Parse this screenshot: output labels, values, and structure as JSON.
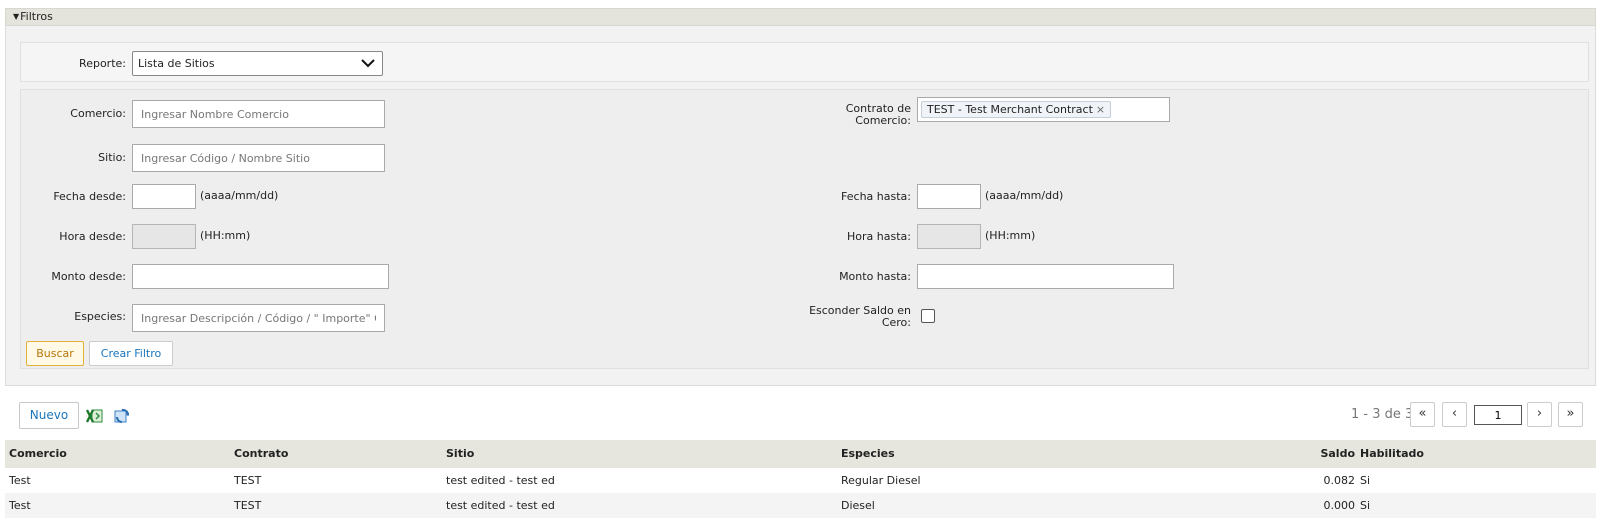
{
  "filters": {
    "header": "Filtros",
    "report": {
      "label": "Reporte:",
      "selected": "Lista de Sitios"
    },
    "comercio": {
      "label": "Comercio:",
      "placeholder": "Ingresar Nombre Comercio"
    },
    "contrato": {
      "label_line1": "Contrato de",
      "label_line2": "Comercio:",
      "tag": "TEST - Test Merchant Contract"
    },
    "sitio": {
      "label": "Sitio:",
      "placeholder": "Ingresar Código / Nombre Sitio"
    },
    "fecha_desde": {
      "label": "Fecha desde:",
      "hint": "(aaaa/mm/dd)"
    },
    "fecha_hasta": {
      "label": "Fecha hasta:",
      "hint": "(aaaa/mm/dd)"
    },
    "hora_desde": {
      "label": "Hora desde:",
      "hint": "(HH:mm)"
    },
    "hora_hasta": {
      "label": "Hora hasta:",
      "hint": "(HH:mm)"
    },
    "monto_desde": {
      "label": "Monto desde:"
    },
    "monto_hasta": {
      "label": "Monto hasta:"
    },
    "especies": {
      "label": "Especies:",
      "placeholder": "Ingresar Descripción / Código / \" Importe\" Coml"
    },
    "esconder": {
      "label_line1": "Esconder Saldo en",
      "label_line2": "Cero:",
      "checked": false
    },
    "buttons": {
      "buscar": "Buscar",
      "crear_filtro": "Crear Filtro"
    }
  },
  "toolbar": {
    "nuevo": "Nuevo",
    "pager_text": "1 - 3 de 3",
    "page_value": "1",
    "first": "«",
    "prev": "‹",
    "next": "›",
    "last": "»"
  },
  "table": {
    "headers": [
      "Comercio",
      "Contrato",
      "Sitio",
      "Especies",
      "Saldo",
      "Habilitado"
    ],
    "rows": [
      [
        "Test",
        "TEST",
        "test edited - test ed",
        "Regular Diesel",
        "0.082",
        "Si"
      ],
      [
        "Test",
        "TEST",
        "test edited - test ed",
        "Diesel",
        "0.000",
        "Si"
      ]
    ]
  },
  "colors": {
    "accent_blue": "#1a75bb",
    "buscar_border": "#e2b13c",
    "header_bg": "#e6e6de"
  }
}
